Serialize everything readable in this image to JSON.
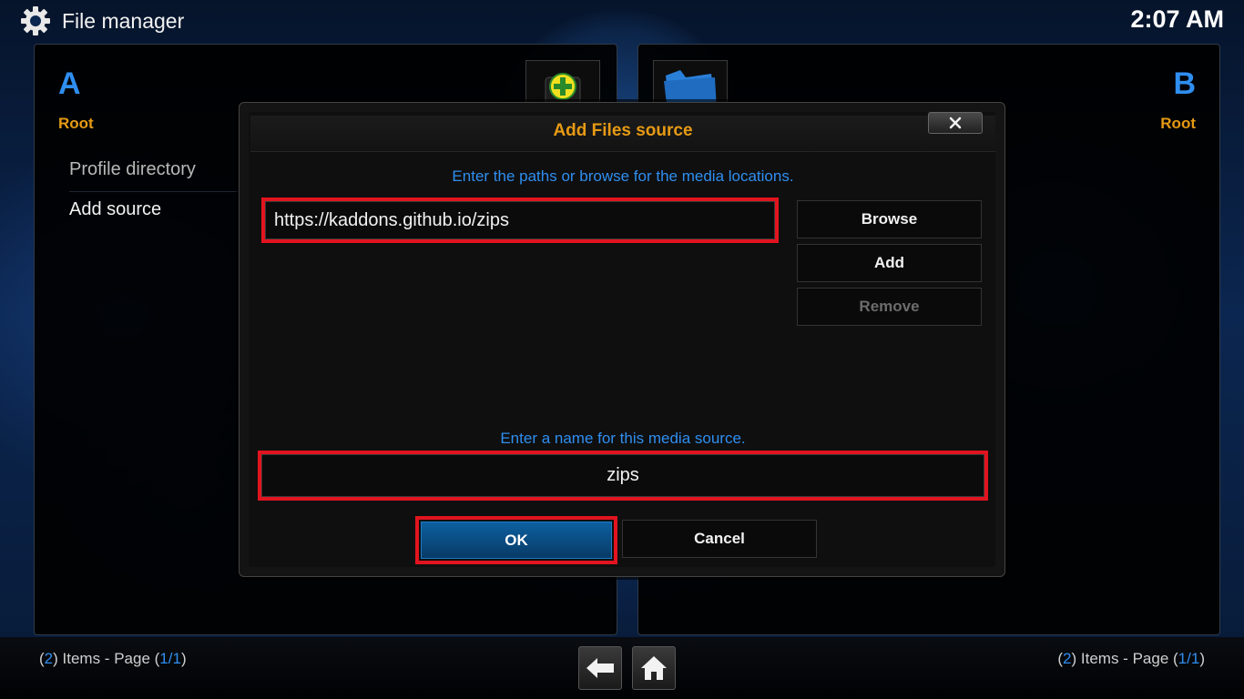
{
  "header": {
    "title": "File manager",
    "clock": "2:07 AM",
    "icon": "gear-icon"
  },
  "panels": {
    "left": {
      "letter": "A",
      "location": "Root",
      "items": [
        "Profile directory",
        "Add source"
      ],
      "count": "2",
      "page_current": "1",
      "page_total": "1"
    },
    "right": {
      "letter": "B",
      "location": "Root",
      "count": "2",
      "page_current": "1",
      "page_total": "1"
    }
  },
  "footer": {
    "items_label": ") Items - Page (",
    "back_icon": "back-arrow-icon",
    "home_icon": "home-icon"
  },
  "dialog": {
    "title": "Add Files source",
    "paths_hint": "Enter the paths or browse for the media locations.",
    "path_value": "https://kaddons.github.io/zips",
    "browse_label": "Browse",
    "add_label": "Add",
    "remove_label": "Remove",
    "name_hint": "Enter a name for this media source.",
    "name_value": "zips",
    "ok_label": "OK",
    "cancel_label": "Cancel",
    "close_icon": "close-icon"
  },
  "colors": {
    "accent_blue": "#2f8ef0",
    "accent_orange": "#e69a14",
    "highlight_red": "#e1141f",
    "focus_blue": "#0a4b80"
  }
}
